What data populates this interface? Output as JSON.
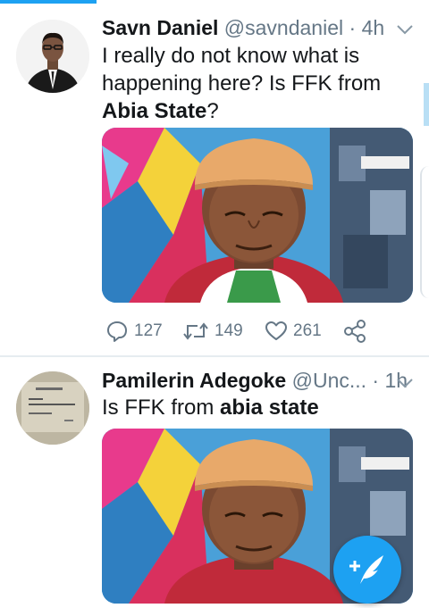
{
  "tweets": [
    {
      "name": "Savn Daniel",
      "handle": "@savndaniel",
      "dot": "·",
      "time": "4h",
      "text_part1": "I really do not know what is happening here? Is FFK from ",
      "text_bold": "Abia State",
      "text_part2": "?",
      "actions": {
        "replies": "127",
        "retweets": "149",
        "likes": "261"
      }
    },
    {
      "name": "Pamilerin Adegoke",
      "handle": "@Unc...",
      "dot": "·",
      "time": "1h",
      "text_part1": "Is FFK from ",
      "text_bold": "abia state",
      "text_part2": ""
    }
  ],
  "icons": {
    "menu": "chevron-down-icon",
    "reply": "reply-icon",
    "retweet": "retweet-icon",
    "like": "heart-icon",
    "share": "share-icon",
    "compose": "compose-icon"
  },
  "colors": {
    "accent": "#1da1f2",
    "secondary_text": "#657786"
  }
}
